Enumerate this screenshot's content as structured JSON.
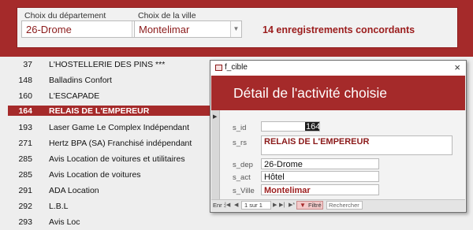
{
  "filter": {
    "department_label": "Choix du département",
    "department_value": "26-Drome",
    "city_label": "Choix de la ville",
    "city_value": "Montelimar",
    "match_text": "14 enregistrements concordants"
  },
  "list": {
    "rows": [
      {
        "id": "37",
        "name": "L'HOSTELLERIE DES PINS ***",
        "selected": false
      },
      {
        "id": "148",
        "name": "Balladins Confort",
        "selected": false
      },
      {
        "id": "160",
        "name": "L'ESCAPADE",
        "selected": false
      },
      {
        "id": "164",
        "name": "RELAIS DE L'EMPEREUR",
        "selected": true
      },
      {
        "id": "193",
        "name": "Laser Game Le Complex Indépendant",
        "selected": false
      },
      {
        "id": "271",
        "name": "Hertz BPA (SA) Franchisé indépendant",
        "selected": false
      },
      {
        "id": "285",
        "name": "Avis Location de voitures et utilitaires",
        "selected": false
      },
      {
        "id": "285",
        "name": "Avis Location de voitures",
        "selected": false
      },
      {
        "id": "291",
        "name": "ADA Location",
        "selected": false
      },
      {
        "id": "292",
        "name": "L.B.L",
        "selected": false
      },
      {
        "id": "293",
        "name": "Avis Loc",
        "selected": false
      }
    ]
  },
  "popup": {
    "window_title": "f_cible",
    "close_glyph": "×",
    "form_title": "Détail de l'activité choisie",
    "fields": {
      "s_id_label": "s_id",
      "s_id_value": "164",
      "s_rs_label": "s_rs",
      "s_rs_value": "RELAIS DE L'EMPEREUR",
      "s_dep_label": "s_dep",
      "s_dep_value": "26-Drome",
      "s_act_label": "s_act",
      "s_act_value": "Hôtel",
      "s_ville_label": "s_Ville",
      "s_ville_value": "Montelimar"
    },
    "nav": {
      "record_label": "Enr :",
      "record_value": "1 sur 1",
      "filtered_label": "Filtré",
      "search_label": "Rechercher"
    }
  },
  "icons": {
    "combo_arrow": "chevron-down-icon",
    "record_selector": "record-selector-arrow-icon",
    "filter": "funnel-icon"
  },
  "colors": {
    "accent": "#a52a2a",
    "accent_text": "#8b1a1a",
    "background": "#eeeeee"
  }
}
